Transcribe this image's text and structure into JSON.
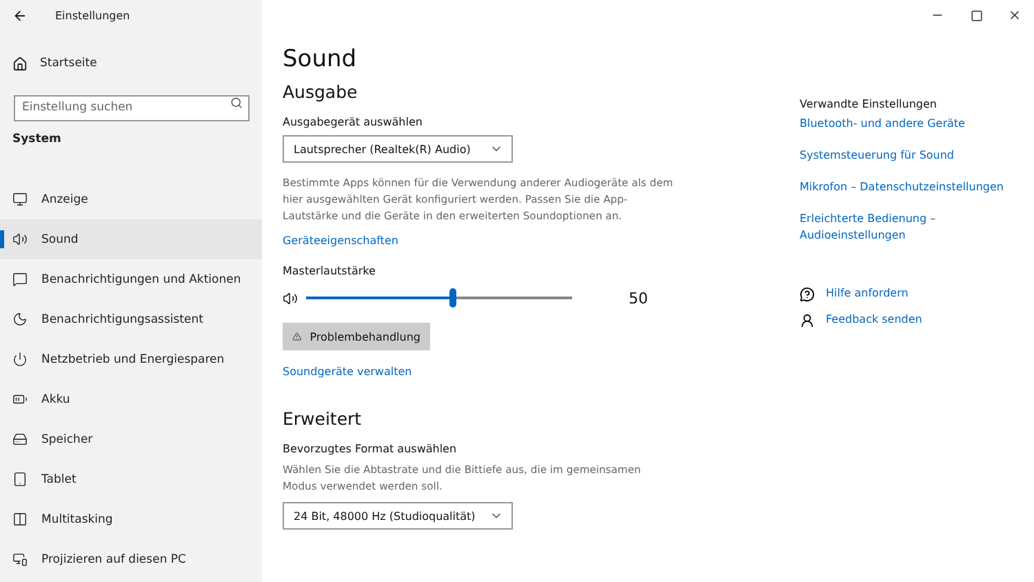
{
  "window": {
    "title": "Einstellungen"
  },
  "sidebar": {
    "home": "Startseite",
    "search": {
      "placeholder": "Einstellung suchen"
    },
    "section": "System",
    "items": [
      {
        "label": "Anzeige",
        "selected": false
      },
      {
        "label": "Sound",
        "selected": true
      },
      {
        "label": "Benachrichtigungen und Aktionen",
        "selected": false
      },
      {
        "label": "Benachrichtigungsassistent",
        "selected": false
      },
      {
        "label": "Netzbetrieb und Energiesparen",
        "selected": false
      },
      {
        "label": "Akku",
        "selected": false
      },
      {
        "label": "Speicher",
        "selected": false
      },
      {
        "label": "Tablet",
        "selected": false
      },
      {
        "label": "Multitasking",
        "selected": false
      },
      {
        "label": "Projizieren auf diesen PC",
        "selected": false
      }
    ]
  },
  "page": {
    "title": "Sound",
    "output": {
      "heading": "Ausgabe",
      "device_label": "Ausgabegerät auswählen",
      "device": "Lautsprecher (Realtek(R) Audio)",
      "description": "Bestimmte Apps können für die Verwendung anderer Audiogeräte als dem hier ausgewählten Gerät konfiguriert werden. Passen Sie die App-Lautstärke und die Geräte in den erweiterten Soundoptionen an.",
      "properties_link": "Geräteeigenschaften",
      "volume_label": "Masterlautstärke",
      "volume": {
        "level": 0.55,
        "reading": "50"
      },
      "troubleshoot": "Problembehandlung",
      "manage_link": "Soundgeräte verwalten"
    },
    "advanced": {
      "heading": "Erweitert",
      "format_label": "Bevorzugtes Format auswählen",
      "description": "Wählen Sie die Abtastrate und die Bittiefe aus, die im gemeinsamen Modus verwendet werden soll.",
      "format": "24 Bit, 48000 Hz (Studioqualität)"
    }
  },
  "related": {
    "heading": "Verwandte Einstellungen",
    "links": [
      "Bluetooth- und andere Geräte",
      "Systemsteuerung für Sound",
      "Mikrofon – Datenschutzeinstellungen",
      "Erleichterte Bedienung – Audioeinstellungen"
    ],
    "help": "Hilfe anfordern",
    "feedback": "Feedback senden"
  }
}
